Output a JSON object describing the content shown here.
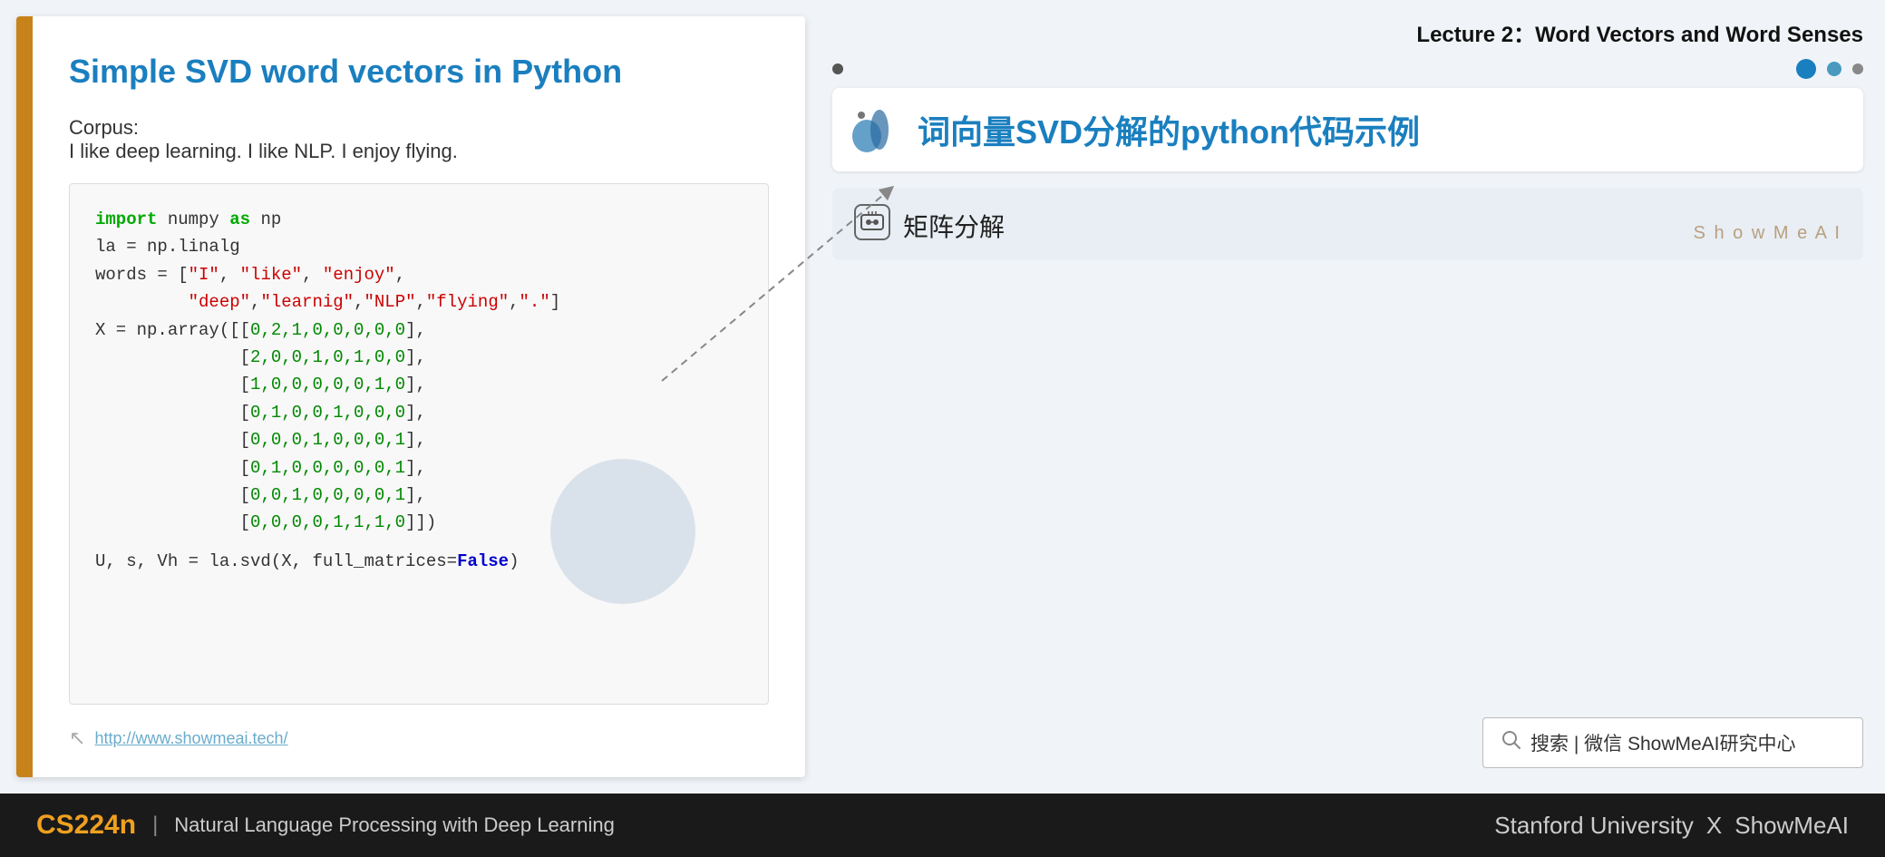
{
  "slide": {
    "title": "Simple SVD word vectors in Python",
    "corpus_label": "Corpus:",
    "corpus_text": "I like deep learning. I like NLP. I enjoy flying.",
    "code_lines": [
      {
        "type": "import",
        "text": "import numpy as np"
      },
      {
        "type": "normal",
        "text": "la = np.linalg"
      },
      {
        "type": "normal_string",
        "text": "words = [\"I\", \"like\", \"enjoy\","
      },
      {
        "type": "normal_string2",
        "text": "         \"deep\",\"learnig\",\"NLP\",\"flying\",\".\"]"
      },
      {
        "type": "array_start",
        "text": "X = np.array([[0,2,1,0,0,0,0,0],"
      },
      {
        "type": "array_row",
        "text": "              [2,0,0,1,0,1,0,0],"
      },
      {
        "type": "array_row",
        "text": "              [1,0,0,0,0,0,1,0],"
      },
      {
        "type": "array_row",
        "text": "              [0,1,0,0,1,0,0,0],"
      },
      {
        "type": "array_row",
        "text": "              [0,0,0,1,0,0,0,1],"
      },
      {
        "type": "array_row",
        "text": "              [0,1,0,0,0,0,0,1],"
      },
      {
        "type": "array_row",
        "text": "              [0,0,1,0,0,0,0,1],"
      },
      {
        "type": "array_end",
        "text": "              [0,0,0,0,1,1,1,0]])"
      },
      {
        "type": "svd",
        "text": "U, s, Vh = la.svd(X, full_matrices=False)"
      }
    ],
    "footer_url": "http://www.showmeai.tech/"
  },
  "right": {
    "lecture_title": "Lecture 2：Word Vectors and Word Senses",
    "chinese_title": "词向量SVD分解的python代码示例",
    "card_text": "矩阵分解",
    "showmeai_watermark": "S h o w M e A I",
    "search_text": "搜索 | 微信 ShowMeAI研究中心"
  },
  "bottom": {
    "cs224n": "CS224n",
    "separator": "|",
    "description": "Natural Language Processing with Deep Learning",
    "stanford": "Stanford University",
    "x": "X",
    "showmeai": "ShowMeAI"
  }
}
